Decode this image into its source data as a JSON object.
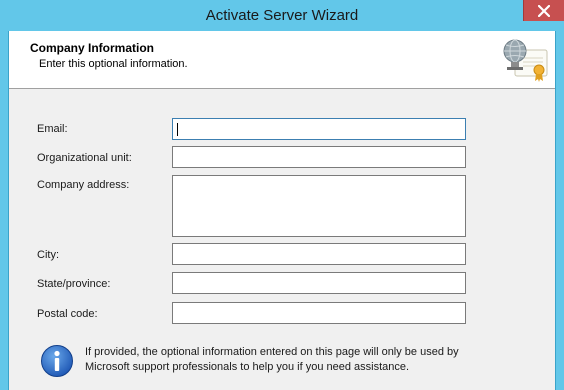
{
  "window": {
    "title": "Activate Server Wizard"
  },
  "header": {
    "title": "Company Information",
    "subtitle": "Enter this optional information.",
    "icon": "certificate-globe-icon"
  },
  "form": {
    "email_label": "Email:",
    "email_value": "",
    "org_unit_label": "Organizational unit:",
    "org_unit_value": "",
    "address_label": "Company address:",
    "address_value": "",
    "city_label": "City:",
    "city_value": "",
    "state_label": "State/province:",
    "state_value": "",
    "postal_label": "Postal code:",
    "postal_value": ""
  },
  "info": {
    "icon": "info-icon",
    "text": "If provided, the optional information entered on this page will only be used by Microsoft support professionals to help you if you need assistance."
  },
  "colors": {
    "titlebar": "#62c7e9",
    "close_button": "#c75050",
    "dialog_background": "#f0f0f0"
  }
}
